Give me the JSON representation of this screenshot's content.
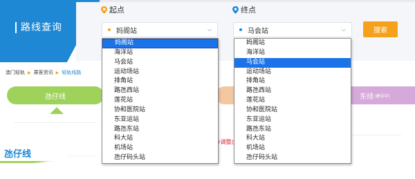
{
  "route_search": {
    "title": "路线查询"
  },
  "origin": {
    "label": "起点",
    "selected": "妈阁站",
    "dot_color": "#f6a11b"
  },
  "destination": {
    "label": "终点",
    "selected": "马会站",
    "dot_color": "#1e88d4"
  },
  "search_button": {
    "label": "搜索"
  },
  "breadcrumb": [
    "澳门轻轨",
    "乘客资讯",
    "轻轨线路"
  ],
  "tabs": {
    "taipa_line": "氹仔线",
    "east_line": "东线",
    "east_line_status": "(建设中)"
  },
  "notice_fragment": "※调整出",
  "section_title": "氹仔线",
  "origin_dropdown": {
    "options": [
      "妈阁站",
      "海洋站",
      "马会站",
      "运动场站",
      "排角站",
      "路氹西站",
      "莲花站",
      "协和医院站",
      "东亚运站",
      "路氹东站",
      "科大站",
      "机场站",
      "氹仔码头站"
    ],
    "highlighted_index": 0
  },
  "destination_dropdown": {
    "options": [
      "妈阁站",
      "海洋站",
      "马会站",
      "运动场站",
      "排角站",
      "路氹西站",
      "莲花站",
      "协和医院站",
      "东亚运站",
      "路氹东站",
      "科大站",
      "机场站",
      "氹仔码头站"
    ],
    "highlighted_index": 2
  },
  "colors": {
    "brand_blue": "#1e88d4",
    "accent_orange": "#f6a11b",
    "line_green": "#9ed25b",
    "line_purple": "#d5a9d9",
    "selection_blue": "#1a73e8"
  }
}
